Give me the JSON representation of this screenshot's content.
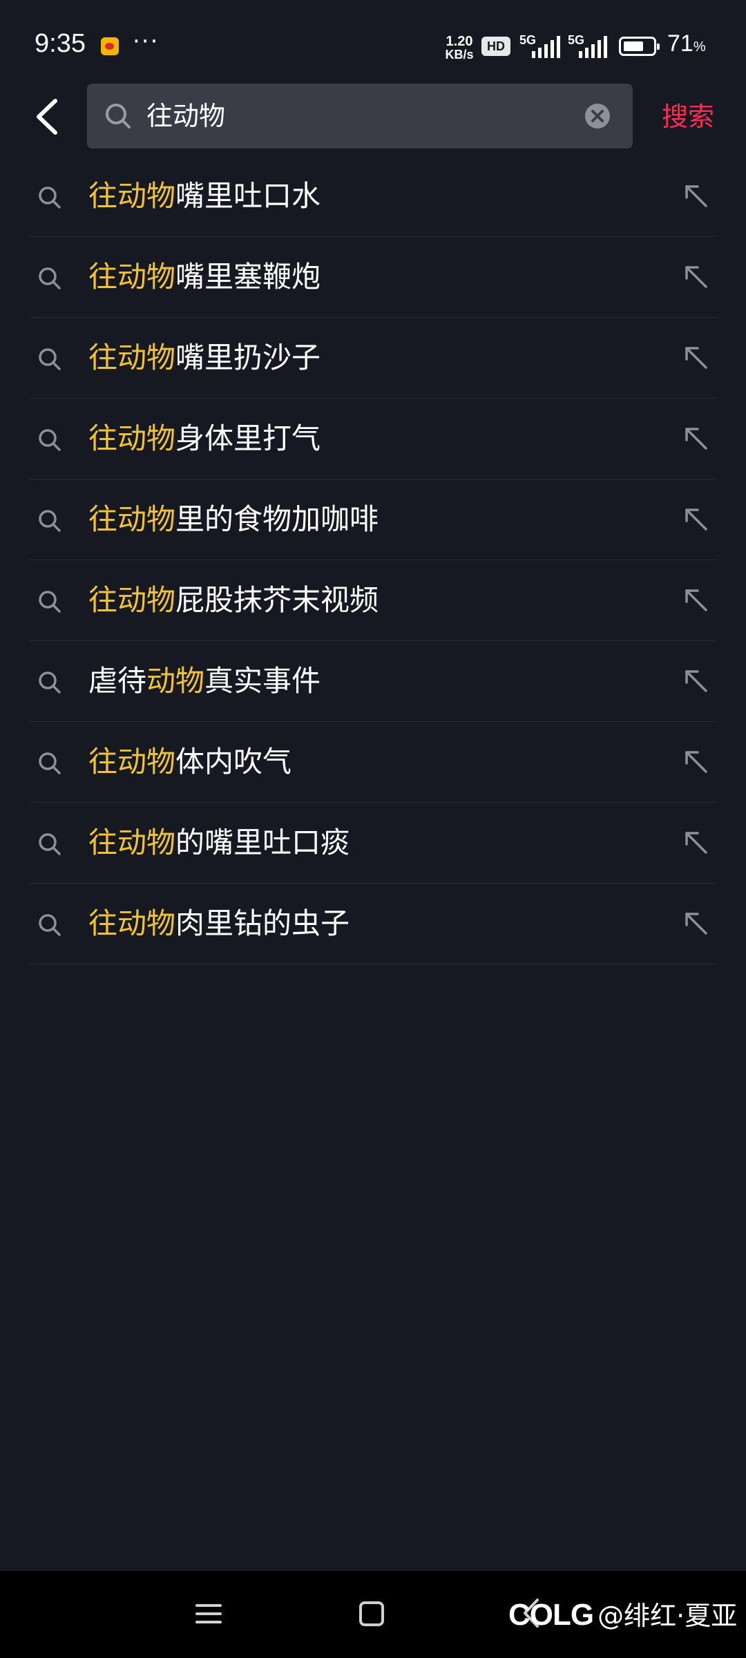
{
  "status_bar": {
    "time": "9:35",
    "more": "···",
    "net_speed_value": "1.20",
    "net_speed_unit": "KB/s",
    "hd_label": "HD",
    "sim1_label": "5G",
    "sim2_label": "5G",
    "battery_level": 0.71,
    "battery_value": "71",
    "battery_unit": "%"
  },
  "search": {
    "query": "往动物",
    "submit_label": "搜索"
  },
  "suggestions": [
    {
      "prefix": "",
      "highlight": "往动物",
      "suffix": "嘴里吐口水"
    },
    {
      "prefix": "",
      "highlight": "往动物",
      "suffix": "嘴里塞鞭炮"
    },
    {
      "prefix": "",
      "highlight": "往动物",
      "suffix": "嘴里扔沙子"
    },
    {
      "prefix": "",
      "highlight": "往动物",
      "suffix": "身体里打气"
    },
    {
      "prefix": "",
      "highlight": "往动物",
      "suffix": "里的食物加咖啡"
    },
    {
      "prefix": "",
      "highlight": "往动物",
      "suffix": "屁股抹芥末视频"
    },
    {
      "prefix": "虐待",
      "highlight": "动物",
      "suffix": "真实事件"
    },
    {
      "prefix": "",
      "highlight": "往动物",
      "suffix": "体内吹气"
    },
    {
      "prefix": "",
      "highlight": "往动物",
      "suffix": "的嘴里吐口痰"
    },
    {
      "prefix": "",
      "highlight": "往动物",
      "suffix": "肉里钻的虫子"
    }
  ],
  "watermark": {
    "logo": "COLG",
    "text": "@绯红·夏亚"
  },
  "colors": {
    "background": "#161922",
    "highlight": "#f4c430",
    "accent": "#fe2c55",
    "search_field": "#3a3d48"
  },
  "icons": {
    "back": "chevron-left-icon",
    "search": "search-icon",
    "clear": "clear-circle-icon",
    "fill": "arrow-up-left-icon",
    "nav_menu": "menu-icon",
    "nav_home": "home-square-icon",
    "nav_back": "nav-back-icon"
  }
}
